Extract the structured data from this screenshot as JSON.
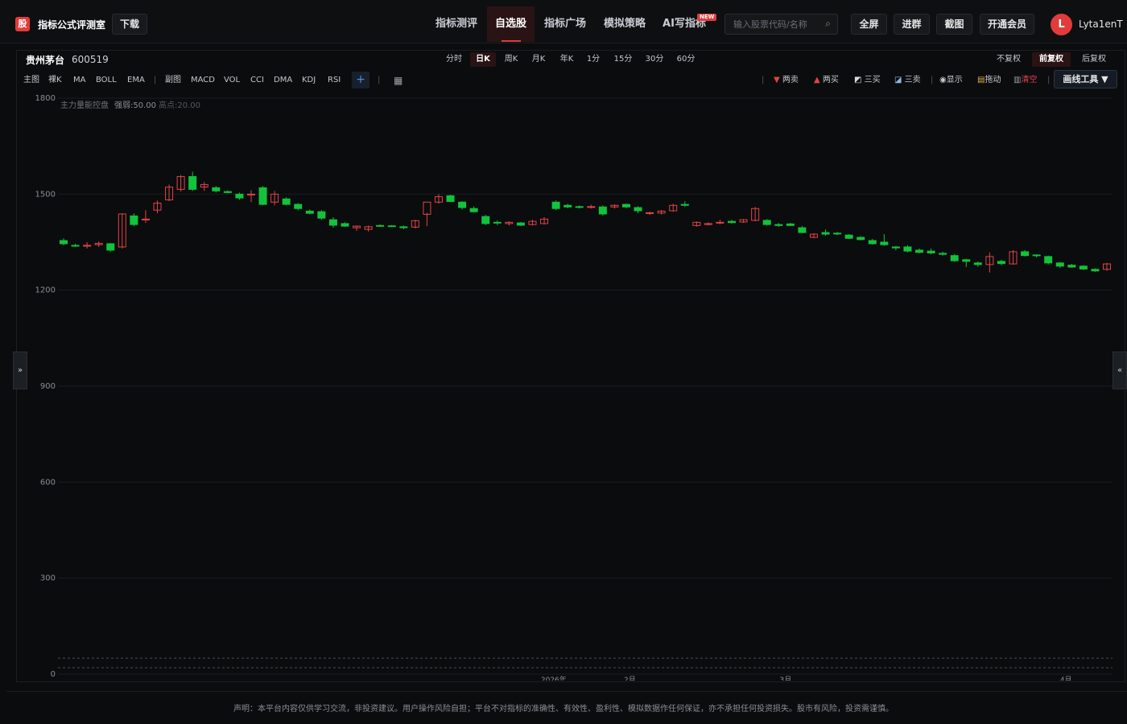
{
  "header": {
    "logo_glyph": "股",
    "site_title": "指标公式评测室",
    "download_label": "下载",
    "nav": [
      {
        "label": "指标测评",
        "active": false
      },
      {
        "label": "自选股",
        "active": true
      },
      {
        "label": "指标广场",
        "active": false
      },
      {
        "label": "模拟策略",
        "active": false
      },
      {
        "label": "AI写指标",
        "active": false
      }
    ],
    "new_badge": "NEW",
    "search_placeholder": "输入股票代码/名称",
    "actions": [
      "全屏",
      "进群",
      "截图",
      "开通会员"
    ],
    "avatar_letter": "L",
    "username": "Lyta1enT"
  },
  "stock": {
    "name": "贵州茅台",
    "code": "600519"
  },
  "periods": [
    {
      "label": "分时",
      "active": false
    },
    {
      "label": "日K",
      "active": true
    },
    {
      "label": "周K",
      "active": false
    },
    {
      "label": "月K",
      "active": false
    },
    {
      "label": "年K",
      "active": false
    },
    {
      "label": "1分",
      "active": false
    },
    {
      "label": "15分",
      "active": false
    },
    {
      "label": "30分",
      "active": false
    },
    {
      "label": "60分",
      "active": false
    }
  ],
  "adjust": [
    {
      "label": "不复权",
      "active": false
    },
    {
      "label": "前复权",
      "active": true
    },
    {
      "label": "后复权",
      "active": false
    }
  ],
  "indicators_main": [
    "主图",
    "裸K",
    "MA",
    "BOLL",
    "EMA"
  ],
  "indicators_sub": [
    "副图",
    "MACD",
    "VOL",
    "CCI",
    "DMA",
    "KDJ",
    "RSI"
  ],
  "tools": {
    "two_sell": "两卖",
    "two_buy": "两买",
    "three_buy": "三买",
    "three_sell": "三卖",
    "show": "显示",
    "drag": "拖动",
    "clear": "清空",
    "draw_tools": "画线工具 ▼"
  },
  "colors": {
    "up": "#e04545",
    "down": "#12c33b",
    "accent": "#e23b3b"
  },
  "chart_data": {
    "type": "candlestick",
    "overlay_text": {
      "name": "主力量能控盘",
      "item1": "强弱:50.00",
      "item2": "高点:20.00"
    },
    "ylim": [
      0,
      1800
    ],
    "yticks": [
      0,
      300,
      600,
      900,
      1200,
      1500,
      1800
    ],
    "reference_lines": [
      50,
      20
    ],
    "x_labels": [
      "2026年",
      "2月",
      "3月",
      "4月"
    ],
    "candles": [
      [
        1355,
        1362,
        1340,
        1345
      ],
      [
        1340,
        1345,
        1335,
        1338
      ],
      [
        1338,
        1350,
        1330,
        1340
      ],
      [
        1342,
        1352,
        1335,
        1346
      ],
      [
        1345,
        1347,
        1320,
        1325
      ],
      [
        1335,
        1440,
        1330,
        1438
      ],
      [
        1432,
        1440,
        1400,
        1405
      ],
      [
        1420,
        1450,
        1410,
        1422
      ],
      [
        1450,
        1480,
        1440,
        1472
      ],
      [
        1482,
        1530,
        1478,
        1522
      ],
      [
        1515,
        1560,
        1508,
        1555
      ],
      [
        1555,
        1570,
        1510,
        1515
      ],
      [
        1522,
        1538,
        1510,
        1530
      ],
      [
        1520,
        1525,
        1505,
        1510
      ],
      [
        1508,
        1512,
        1502,
        1505
      ],
      [
        1500,
        1505,
        1482,
        1488
      ],
      [
        1500,
        1512,
        1475,
        1500
      ],
      [
        1520,
        1525,
        1465,
        1468
      ],
      [
        1475,
        1510,
        1465,
        1500
      ],
      [
        1485,
        1490,
        1465,
        1468
      ],
      [
        1468,
        1472,
        1450,
        1455
      ],
      [
        1447,
        1452,
        1437,
        1440
      ],
      [
        1445,
        1450,
        1420,
        1425
      ],
      [
        1420,
        1428,
        1395,
        1403
      ],
      [
        1408,
        1412,
        1398,
        1400
      ],
      [
        1395,
        1402,
        1385,
        1400
      ],
      [
        1390,
        1402,
        1383,
        1398
      ],
      [
        1402,
        1405,
        1398,
        1400
      ],
      [
        1401,
        1403,
        1397,
        1399
      ],
      [
        1398,
        1402,
        1390,
        1395
      ],
      [
        1397,
        1420,
        1393,
        1417
      ],
      [
        1437,
        1442,
        1400,
        1475
      ],
      [
        1475,
        1500,
        1470,
        1492
      ],
      [
        1495,
        1498,
        1475,
        1477
      ],
      [
        1475,
        1478,
        1452,
        1458
      ],
      [
        1455,
        1462,
        1442,
        1445
      ],
      [
        1430,
        1435,
        1403,
        1408
      ],
      [
        1412,
        1418,
        1403,
        1410
      ],
      [
        1408,
        1415,
        1402,
        1412
      ],
      [
        1410,
        1413,
        1400,
        1403
      ],
      [
        1405,
        1420,
        1402,
        1415
      ],
      [
        1408,
        1428,
        1405,
        1422
      ],
      [
        1475,
        1480,
        1450,
        1455
      ],
      [
        1465,
        1470,
        1456,
        1460
      ],
      [
        1461,
        1465,
        1455,
        1459
      ],
      [
        1460,
        1467,
        1455,
        1461
      ],
      [
        1460,
        1465,
        1433,
        1438
      ],
      [
        1460,
        1468,
        1455,
        1465
      ],
      [
        1468,
        1470,
        1456,
        1460
      ],
      [
        1458,
        1462,
        1440,
        1448
      ],
      [
        1440,
        1445,
        1435,
        1442
      ],
      [
        1441,
        1450,
        1436,
        1447
      ],
      [
        1448,
        1470,
        1445,
        1465
      ],
      [
        1468,
        1478,
        1460,
        1465
      ],
      [
        1402,
        1415,
        1398,
        1412
      ],
      [
        1405,
        1412,
        1402,
        1408
      ],
      [
        1410,
        1420,
        1406,
        1412
      ],
      [
        1415,
        1420,
        1408,
        1411
      ],
      [
        1413,
        1422,
        1410,
        1420
      ],
      [
        1418,
        1460,
        1415,
        1455
      ],
      [
        1418,
        1422,
        1402,
        1405
      ],
      [
        1405,
        1410,
        1398,
        1402
      ],
      [
        1407,
        1410,
        1400,
        1402
      ],
      [
        1395,
        1400,
        1378,
        1380
      ],
      [
        1365,
        1378,
        1362,
        1375
      ],
      [
        1380,
        1390,
        1370,
        1375
      ],
      [
        1378,
        1382,
        1372,
        1376
      ],
      [
        1372,
        1375,
        1360,
        1362
      ],
      [
        1365,
        1368,
        1355,
        1358
      ],
      [
        1355,
        1360,
        1342,
        1345
      ],
      [
        1350,
        1375,
        1338,
        1342
      ],
      [
        1335,
        1338,
        1325,
        1332
      ],
      [
        1335,
        1340,
        1318,
        1322
      ],
      [
        1325,
        1330,
        1315,
        1318
      ],
      [
        1322,
        1330,
        1312,
        1316
      ],
      [
        1315,
        1320,
        1308,
        1312
      ],
      [
        1308,
        1312,
        1288,
        1292
      ],
      [
        1295,
        1298,
        1272,
        1290
      ],
      [
        1285,
        1290,
        1273,
        1280
      ],
      [
        1280,
        1318,
        1255,
        1305
      ],
      [
        1290,
        1295,
        1278,
        1283
      ],
      [
        1282,
        1325,
        1280,
        1320
      ],
      [
        1320,
        1325,
        1305,
        1308
      ],
      [
        1310,
        1312,
        1302,
        1308
      ],
      [
        1305,
        1308,
        1280,
        1285
      ],
      [
        1285,
        1288,
        1270,
        1275
      ],
      [
        1278,
        1282,
        1270,
        1272
      ],
      [
        1275,
        1278,
        1263,
        1266
      ],
      [
        1265,
        1268,
        1257,
        1260
      ],
      [
        1265,
        1285,
        1260,
        1282
      ]
    ]
  },
  "disclaimer": "声明：本平台内容仅供学习交流，非投资建议。用户操作风险自担；平台不对指标的准确性、有效性、盈利性、模拟数据作任何保证，亦不承担任何投资损失。股市有风险，投资需谨慎。"
}
